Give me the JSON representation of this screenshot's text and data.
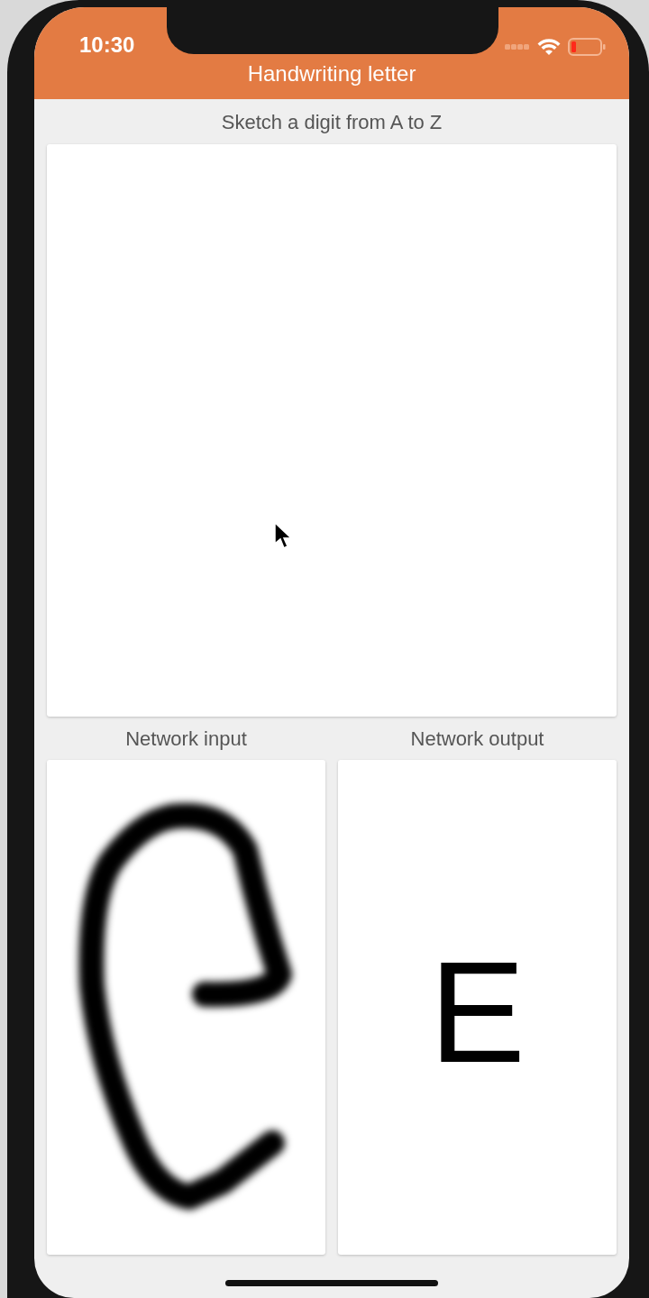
{
  "status_bar": {
    "time": "10:30"
  },
  "header": {
    "title": "Handwriting letter"
  },
  "sketch": {
    "prompt": "Sketch a digit from A to Z"
  },
  "network_input": {
    "label": "Network input"
  },
  "network_output": {
    "label": "Network output",
    "prediction": "E"
  }
}
